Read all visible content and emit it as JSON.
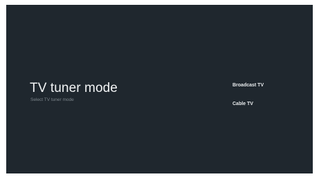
{
  "screen": {
    "title": "TV tuner mode",
    "subtitle": "Select TV tuner mode"
  },
  "options": [
    {
      "label": "Broadcast TV"
    },
    {
      "label": "Cable TV"
    }
  ],
  "colors": {
    "background": "#1f272e",
    "title": "#f2f4f5",
    "subtitle": "#7d868c",
    "option": "#e8ebed"
  }
}
